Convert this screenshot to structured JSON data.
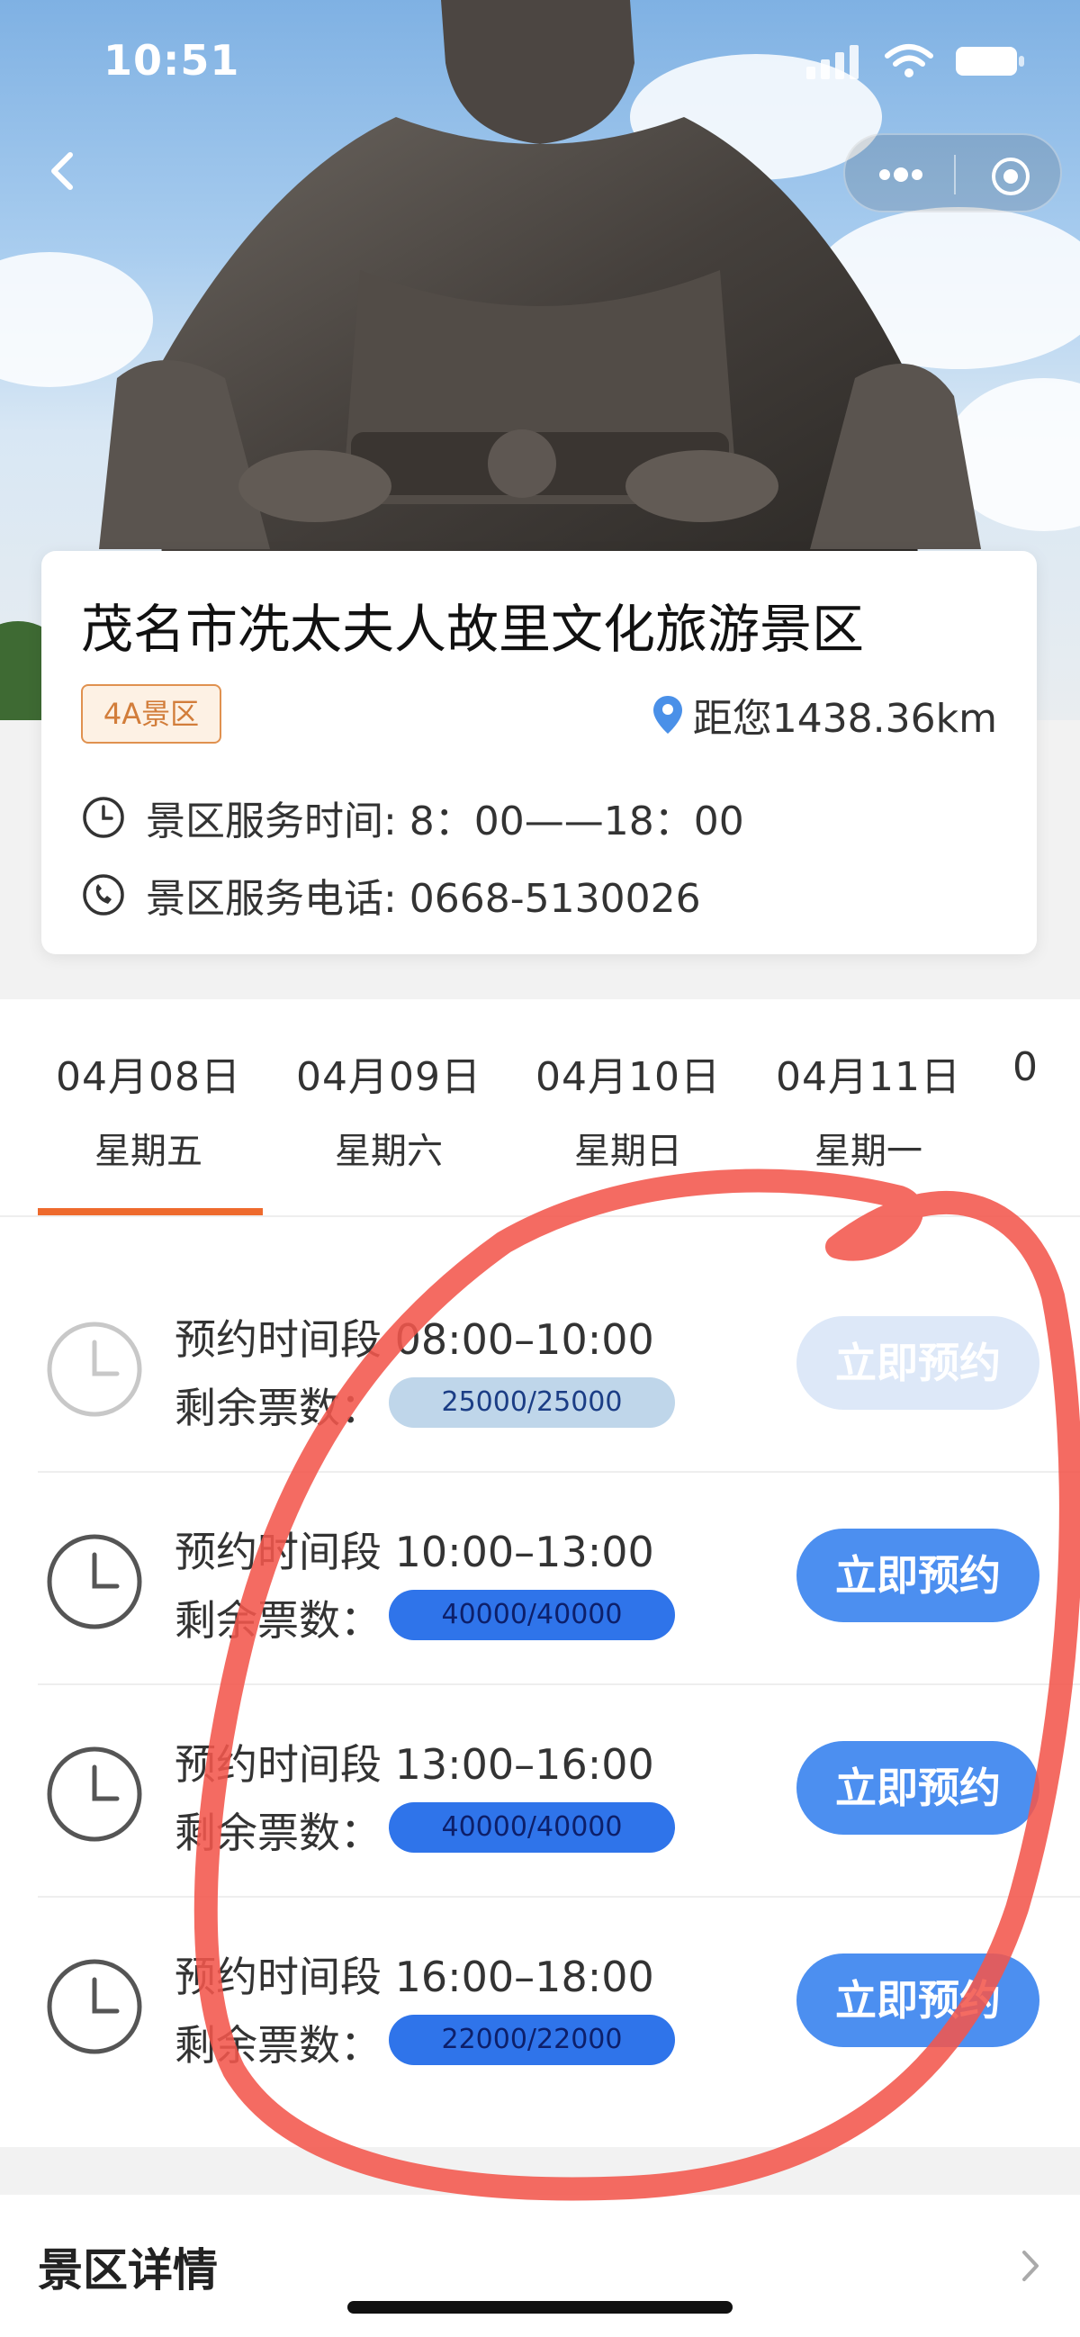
{
  "status_bar": {
    "time": "10:51"
  },
  "spot": {
    "name": "茂名市冼太夫人故里文化旅游景区",
    "badge": "4A景区",
    "distance": "距您1438.36km",
    "service_hours": "景区服务时间: 8：00——18：00",
    "service_phone": "景区服务电话: 0668-5130026"
  },
  "date_tabs": [
    {
      "date": "04月08日",
      "weekday": "星期五"
    },
    {
      "date": "04月09日",
      "weekday": "星期六"
    },
    {
      "date": "04月10日",
      "weekday": "星期日"
    },
    {
      "date": "04月11日",
      "weekday": "星期一"
    },
    {
      "date": "0",
      "weekday": ""
    }
  ],
  "selected_tab": 0,
  "slots": [
    {
      "time_label": "预约时间段 08:00–10:00",
      "remain_label": "剩余票数：",
      "remain": "25000/25000",
      "button": "立即预约",
      "enabled": false
    },
    {
      "time_label": "预约时间段 10:00–13:00",
      "remain_label": "剩余票数：",
      "remain": "40000/40000",
      "button": "立即预约",
      "enabled": true
    },
    {
      "time_label": "预约时间段 13:00–16:00",
      "remain_label": "剩余票数：",
      "remain": "40000/40000",
      "button": "立即预约",
      "enabled": true
    },
    {
      "time_label": "预约时间段 16:00–18:00",
      "remain_label": "剩余票数：",
      "remain": "22000/22000",
      "button": "立即预约",
      "enabled": true
    }
  ],
  "detail": {
    "label": "景区详情"
  },
  "colors": {
    "accent": "#ee6a2d",
    "button_blue": "#4c8ff0",
    "annotation_red": "#f2574c"
  }
}
